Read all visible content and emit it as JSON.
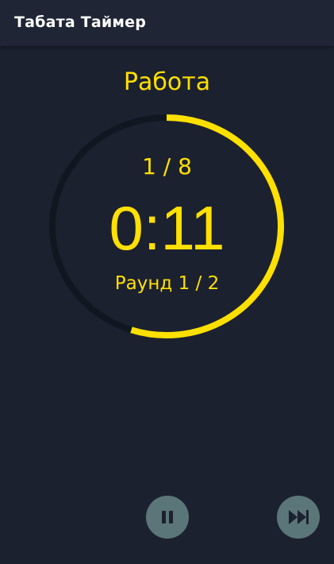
{
  "app_bar": {
    "title": "Табата Таймер"
  },
  "timer": {
    "phase": "Работа",
    "set_counter": "1 / 8",
    "time": "0:11",
    "round_counter": "Раунд 1 / 2",
    "progress_fraction": 0.55
  },
  "controls": {
    "pause_icon": "pause-icon",
    "skip_icon": "fast-forward-icon"
  },
  "colors": {
    "background": "#1c2130",
    "app_bar": "#1f2534",
    "accent": "#ffe000",
    "ring_track": "#0f1820",
    "button": "#5b7678",
    "icon": "#1c2130"
  }
}
